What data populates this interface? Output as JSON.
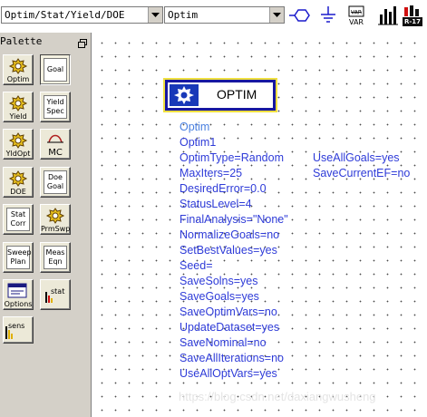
{
  "toolbar": {
    "library_combo_value": "Optim/Stat/Yield/DOE",
    "component_combo_value": "Optim",
    "icons": [
      "port-icon",
      "ground-icon",
      "var-icon",
      "bar-chart-icon",
      "r17-icon"
    ],
    "var_label": "VAR",
    "r17_label": "R-17"
  },
  "palette": {
    "title": "Palette",
    "items": [
      {
        "label": "Optim",
        "icon": "optim-icon"
      },
      {
        "label": "Goal",
        "icon": "goal-icon"
      },
      {
        "label": "Yield",
        "icon": "yield-icon"
      },
      {
        "label": "Yield\nSpec",
        "icon": "yield-spec-icon"
      },
      {
        "label": "YldOpt",
        "icon": "yield-opt-icon"
      },
      {
        "label": "MC",
        "icon": "monte-carlo-icon"
      },
      {
        "label": "DOE",
        "icon": "doe-icon"
      },
      {
        "label": "Doe\nGoal",
        "icon": "doe-goal-icon"
      },
      {
        "label": "Stat\nCorr",
        "icon": "stat-corr-icon"
      },
      {
        "label": "PrmSwp",
        "icon": "param-sweep-icon"
      },
      {
        "label": "Sweep\nPlan",
        "icon": "sweep-plan-icon"
      },
      {
        "label": "Meas\nEqn",
        "icon": "meas-eqn-icon"
      },
      {
        "label": "Options",
        "icon": "options-icon"
      },
      {
        "label": "stat",
        "icon": "stat-icon"
      },
      {
        "label": "sens",
        "icon": "sens-icon"
      }
    ]
  },
  "component": {
    "label": "OPTIM",
    "type_name": "Optim",
    "instance_name": "Optim1",
    "params_left": [
      "OptimType=Random",
      "MaxIters=25",
      "DesiredError=0.0",
      "StatusLevel=4",
      "FinalAnalysis=\"None\"",
      "NormalizeGoals=no",
      "SetBestValues=yes",
      "Seed=",
      "SaveSolns=yes",
      "SaveGoals=yes",
      "SaveOptimVars=no",
      "UpdateDataset=yes",
      "SaveNominal=no",
      "SaveAllIterations=no",
      "UseAllOptVars=yes"
    ],
    "params_right": [
      "UseAllGoals=yes",
      "SaveCurrentEF=no"
    ]
  },
  "watermark": "https://blog.csdn.net/daxiangwusheng",
  "colors": {
    "param_text": "#2e3bd8",
    "component_border": "#1818a0",
    "component_highlight": "#f0e040",
    "palette_bg": "#d4d0c8"
  }
}
